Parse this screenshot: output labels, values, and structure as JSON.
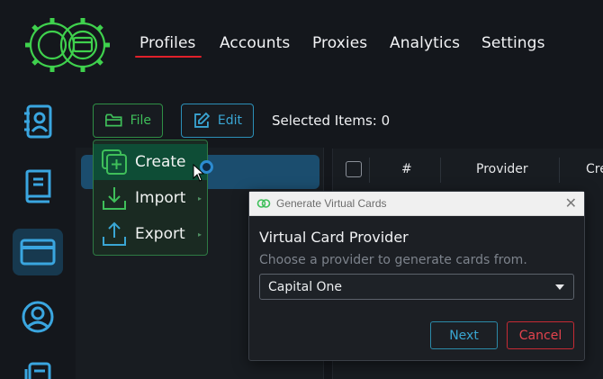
{
  "nav": {
    "items": [
      {
        "label": "Profiles",
        "active": true
      },
      {
        "label": "Accounts"
      },
      {
        "label": "Proxies"
      },
      {
        "label": "Analytics"
      },
      {
        "label": "Settings"
      }
    ],
    "logo_icon": "gear-logo-icon"
  },
  "sidebar": {
    "items": [
      {
        "icon": "contacts-book-icon"
      },
      {
        "icon": "book-icon"
      },
      {
        "icon": "credit-card-icon",
        "active": true
      },
      {
        "icon": "user-circle-icon"
      },
      {
        "icon": "documents-icon"
      }
    ]
  },
  "toolbar": {
    "file_label": "File",
    "edit_label": "Edit",
    "selected_items": "Selected Items: 0"
  },
  "menu": {
    "items": [
      {
        "label": "Create",
        "icon": "create-square-icon",
        "hovered": true
      },
      {
        "label": "Import",
        "icon": "import-icon"
      },
      {
        "label": "Export",
        "icon": "export-icon"
      }
    ]
  },
  "table": {
    "columns": [
      "#",
      "Provider",
      "Cre"
    ]
  },
  "dialog": {
    "title": "Generate Virtual Cards",
    "heading": "Virtual Card Provider",
    "subtitle": "Choose a provider to generate cards from.",
    "selected_provider": "Capital One",
    "next_label": "Next",
    "cancel_label": "Cancel"
  },
  "colors": {
    "accent_green": "#3fbf5a",
    "accent_blue": "#3aa6d4",
    "accent_red": "#e0202a",
    "background": "#14171c"
  }
}
